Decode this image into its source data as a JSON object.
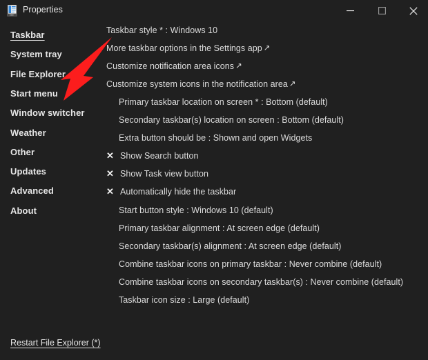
{
  "window": {
    "title": "Properties",
    "icon": "taskbar-properties-icon",
    "background_color": "#202020",
    "controls": {
      "minimize_label": "—",
      "maximize_label": "□",
      "close_label": "✕",
      "minimize_name": "minimize",
      "maximize_name": "maximize",
      "close_name": "close"
    }
  },
  "sidebar": {
    "items": [
      {
        "label": "Taskbar",
        "active": true
      },
      {
        "label": "System tray",
        "active": false
      },
      {
        "label": "File Explorer",
        "active": false
      },
      {
        "label": "Start menu",
        "active": false
      },
      {
        "label": "Window switcher",
        "active": false
      },
      {
        "label": "Weather",
        "active": false
      },
      {
        "label": "Other",
        "active": false
      },
      {
        "label": "Updates",
        "active": false
      },
      {
        "label": "Advanced",
        "active": false
      },
      {
        "label": "About",
        "active": false
      }
    ]
  },
  "content": {
    "rows": [
      {
        "type": "value",
        "text": "Taskbar style * : Windows 10"
      },
      {
        "type": "link",
        "text": "More taskbar options in the Settings app",
        "arrow": "↗"
      },
      {
        "type": "link",
        "text": "Customize notification area icons",
        "arrow": "↗"
      },
      {
        "type": "link",
        "text": "Customize system icons in the notification area",
        "arrow": "↗"
      },
      {
        "type": "indent",
        "text": "Primary taskbar location on screen * : Bottom (default)"
      },
      {
        "type": "indent",
        "text": "Secondary taskbar(s) location on screen : Bottom (default)"
      },
      {
        "type": "indent",
        "text": "Extra button should be : Shown and open Widgets"
      },
      {
        "type": "checked",
        "text": "Show Search button",
        "mark": "✕"
      },
      {
        "type": "checked",
        "text": "Show Task view button",
        "mark": "✕"
      },
      {
        "type": "checked",
        "text": "Automatically hide the taskbar",
        "mark": "✕"
      },
      {
        "type": "indent",
        "text": "Start button style : Windows 10 (default)"
      },
      {
        "type": "indent",
        "text": "Primary taskbar alignment : At screen edge (default)"
      },
      {
        "type": "indent",
        "text": "Secondary taskbar(s) alignment : At screen edge (default)"
      },
      {
        "type": "indent",
        "text": "Combine taskbar icons on primary taskbar : Never combine (default)"
      },
      {
        "type": "indent",
        "text": "Combine taskbar icons on secondary taskbar(s) : Never combine (default)"
      },
      {
        "type": "indent",
        "text": "Taskbar icon size : Large (default)"
      }
    ]
  },
  "footer": {
    "restart_link": "Restart File Explorer (*)"
  },
  "annotation": {
    "type": "arrow",
    "color": "#fc1d1d",
    "points_to": "Start menu"
  }
}
